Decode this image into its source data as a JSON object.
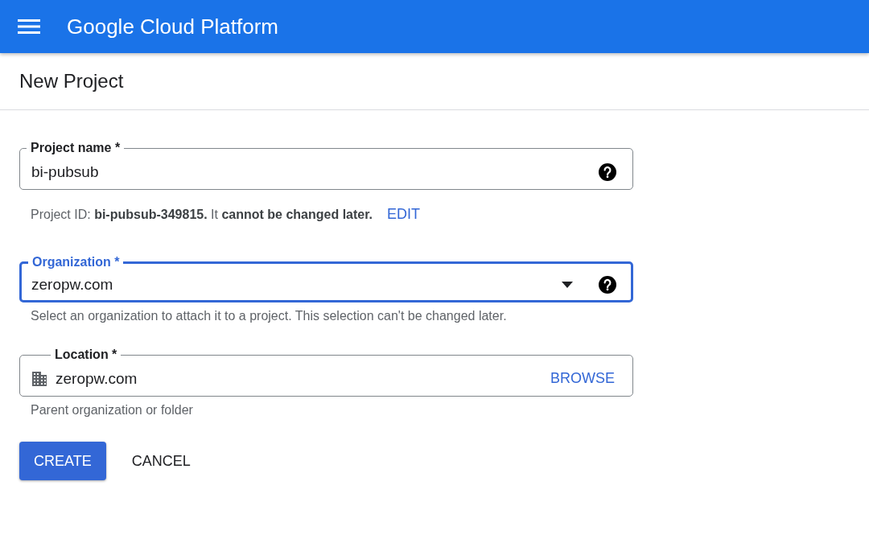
{
  "app_bar": {
    "title": "Google Cloud Platform"
  },
  "page": {
    "title": "New Project"
  },
  "fields": [
    {
      "kind": "text",
      "label": "Project name *",
      "value": "bi-pubsub",
      "focused": false,
      "hint": "Project ID: **bi-pubsub-349815.** It **cannot be changed later.**",
      "hint_link": "EDIT"
    },
    {
      "kind": "dropdown",
      "label": "Organization *",
      "value": "zeropw.com",
      "focused": true,
      "hint": "Select an organization to attach it to a project. This selection can't be changed later."
    },
    {
      "kind": "location",
      "label": "Location *",
      "value": "zeropw.com",
      "focused": false,
      "action": "BROWSE",
      "hint": "Parent organization or folder"
    }
  ],
  "buttons": [
    {
      "label": "CREATE",
      "kind": "primary"
    },
    {
      "label": "CANCEL",
      "kind": "text"
    }
  ]
}
